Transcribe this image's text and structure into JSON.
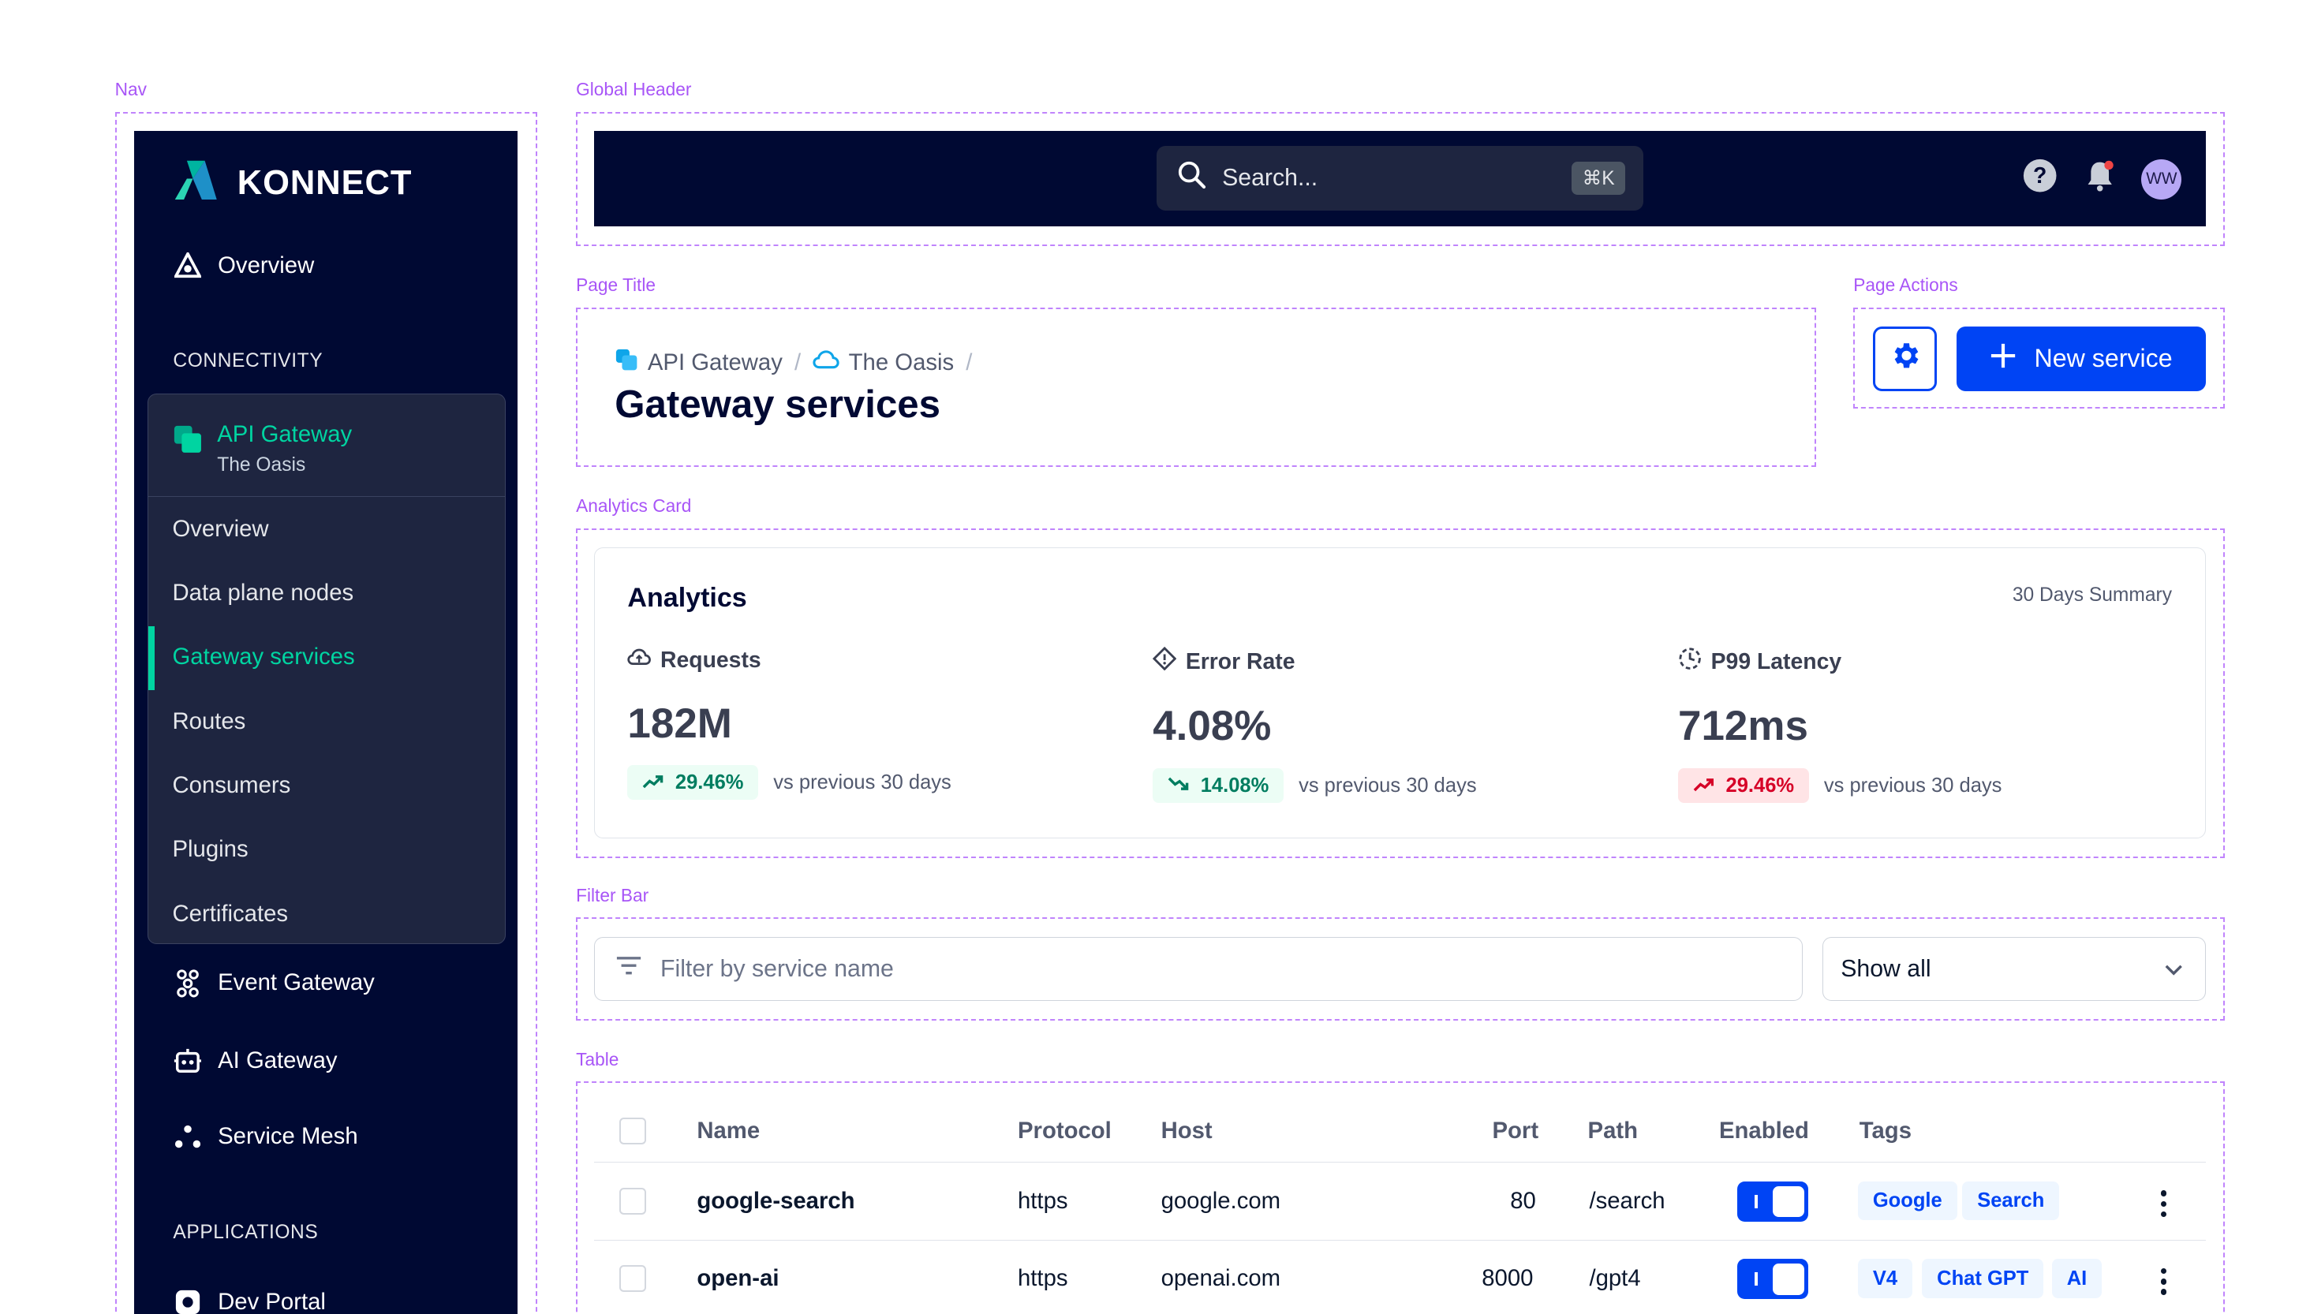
{
  "labels": {
    "nav": "Nav",
    "global_header": "Global Header",
    "page_title": "Page Title",
    "page_actions": "Page Actions",
    "analytics_card": "Analytics Card",
    "filter_bar": "Filter Bar",
    "table": "Table"
  },
  "nav": {
    "brand": "KONNECT",
    "overview": "Overview",
    "section_connectivity": "CONNECTIVITY",
    "group_title": "API Gateway",
    "group_sub": "The Oasis",
    "sub_items": [
      "Overview",
      "Data plane nodes",
      "Gateway services",
      "Routes",
      "Consumers",
      "Plugins",
      "Certificates"
    ],
    "event_gateway": "Event Gateway",
    "ai_gateway": "AI Gateway",
    "service_mesh": "Service Mesh",
    "section_applications": "APPLICATIONS",
    "dev_portal": "Dev Portal"
  },
  "header": {
    "search_placeholder": "Search...",
    "shortcut": "⌘K",
    "avatar_initials": "WW"
  },
  "page": {
    "breadcrumb_1": "API Gateway",
    "breadcrumb_2": "The Oasis",
    "sep": "/",
    "title": "Gateway services"
  },
  "actions": {
    "new_service": "New service"
  },
  "analytics": {
    "title": "Analytics",
    "summary": "30 Days Summary",
    "comparison": "vs previous 30 days",
    "metrics": [
      {
        "label": "Requests",
        "value": "182M",
        "change": "29.46%",
        "direction": "up",
        "sentiment": "good"
      },
      {
        "label": "Error Rate",
        "value": "4.08%",
        "change": "14.08%",
        "direction": "down",
        "sentiment": "good"
      },
      {
        "label": "P99 Latency",
        "value": "712ms",
        "change": "29.46%",
        "direction": "up",
        "sentiment": "bad"
      }
    ]
  },
  "filter": {
    "placeholder": "Filter by service name",
    "select_value": "Show all"
  },
  "table": {
    "columns": [
      "Name",
      "Protocol",
      "Host",
      "Port",
      "Path",
      "Enabled",
      "Tags"
    ],
    "rows": [
      {
        "name": "google-search",
        "protocol": "https",
        "host": "google.com",
        "port": "80",
        "path": "/search",
        "enabled": true,
        "tags": [
          "Google",
          "Search"
        ]
      },
      {
        "name": "open-ai",
        "protocol": "https",
        "host": "openai.com",
        "port": "8000",
        "path": "/gpt4",
        "enabled": true,
        "tags": [
          "V4",
          "Chat GPT",
          "AI"
        ]
      }
    ]
  },
  "colors": {
    "nav_bg": "#000933",
    "accent_green": "#00d4a1",
    "primary_blue": "#0044f4",
    "annotation_purple": "#a855f7"
  }
}
